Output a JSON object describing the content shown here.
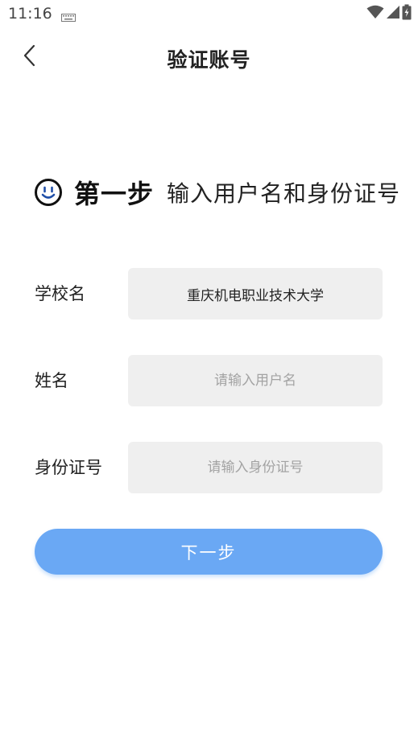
{
  "status_bar": {
    "time": "11:16",
    "icons": [
      "keyboard-icon",
      "wifi-icon",
      "signal-icon",
      "battery-charging-icon"
    ]
  },
  "header": {
    "title": "验证账号",
    "back_icon": "chevron-left-icon"
  },
  "step": {
    "icon": "smile-icon",
    "icon_color": "#1f4fa8",
    "label": "第一步",
    "description": "输入用户名和身份证号"
  },
  "form": {
    "school": {
      "label": "学校名",
      "value": "重庆机电职业技术大学"
    },
    "name": {
      "label": "姓名",
      "value": "",
      "placeholder": "请输入用户名"
    },
    "id_number": {
      "label": "身份证号",
      "value": "",
      "placeholder": "请输入身份证号"
    }
  },
  "next_button": {
    "label": "下一步",
    "color": "#6aa8f4"
  }
}
